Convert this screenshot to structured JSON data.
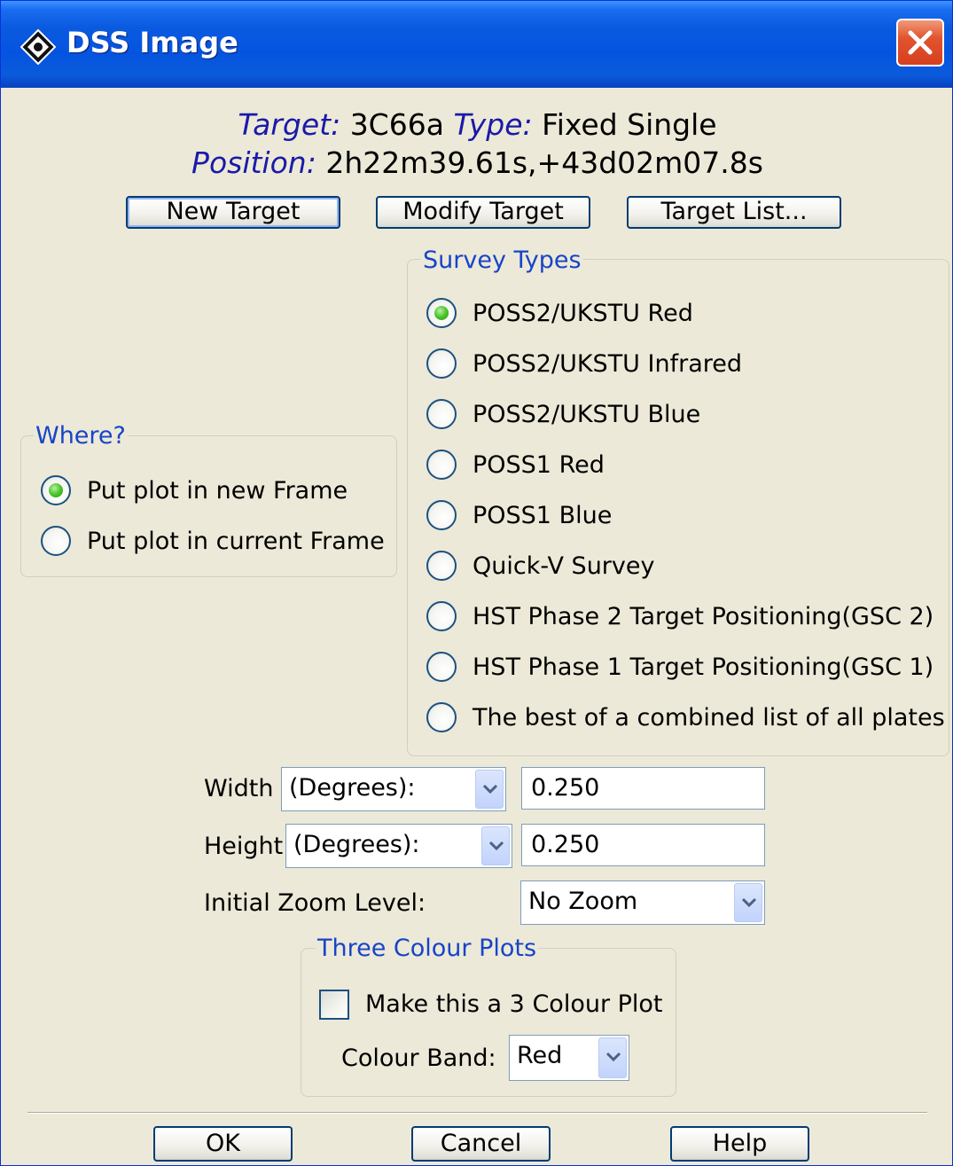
{
  "window": {
    "title": "DSS Image"
  },
  "header": {
    "target_label": "Target:",
    "target_value": "3C66a",
    "type_label": "Type:",
    "type_value": "Fixed Single",
    "position_label": "Position:",
    "position_value": "2h22m39.61s,+43d02m07.8s"
  },
  "target_buttons": {
    "new": "New Target",
    "modify": "Modify Target",
    "list": "Target List..."
  },
  "where": {
    "legend": "Where?",
    "options": [
      {
        "label": "Put plot in new Frame",
        "selected": true
      },
      {
        "label": "Put plot in current Frame",
        "selected": false
      }
    ]
  },
  "survey": {
    "legend": "Survey Types",
    "options": [
      {
        "label": "POSS2/UKSTU Red",
        "selected": true
      },
      {
        "label": "POSS2/UKSTU Infrared",
        "selected": false
      },
      {
        "label": "POSS2/UKSTU Blue",
        "selected": false
      },
      {
        "label": "POSS1 Red",
        "selected": false
      },
      {
        "label": "POSS1 Blue",
        "selected": false
      },
      {
        "label": "Quick-V Survey",
        "selected": false
      },
      {
        "label": "HST Phase 2 Target Positioning(GSC 2)",
        "selected": false
      },
      {
        "label": "HST Phase 1 Target Positioning(GSC 1)",
        "selected": false
      },
      {
        "label": "The best of a combined list of all plates",
        "selected": false
      }
    ]
  },
  "size": {
    "width_label": "Width",
    "width_unit": "(Degrees):",
    "width_value": "0.250",
    "height_label": "Height",
    "height_unit": "(Degrees):",
    "height_value": "0.250",
    "zoom_label": "Initial Zoom Level:",
    "zoom_value": "No Zoom"
  },
  "three_colour": {
    "legend": "Three Colour Plots",
    "checkbox_label": "Make this a 3 Colour Plot",
    "checked": false,
    "band_label": "Colour Band:",
    "band_value": "Red"
  },
  "footer": {
    "ok": "OK",
    "cancel": "Cancel",
    "help": "Help"
  },
  "colors": {
    "selected_radio": "#4bc32c",
    "legend_text": "#1844c8",
    "title_bar": "#0554e0"
  }
}
